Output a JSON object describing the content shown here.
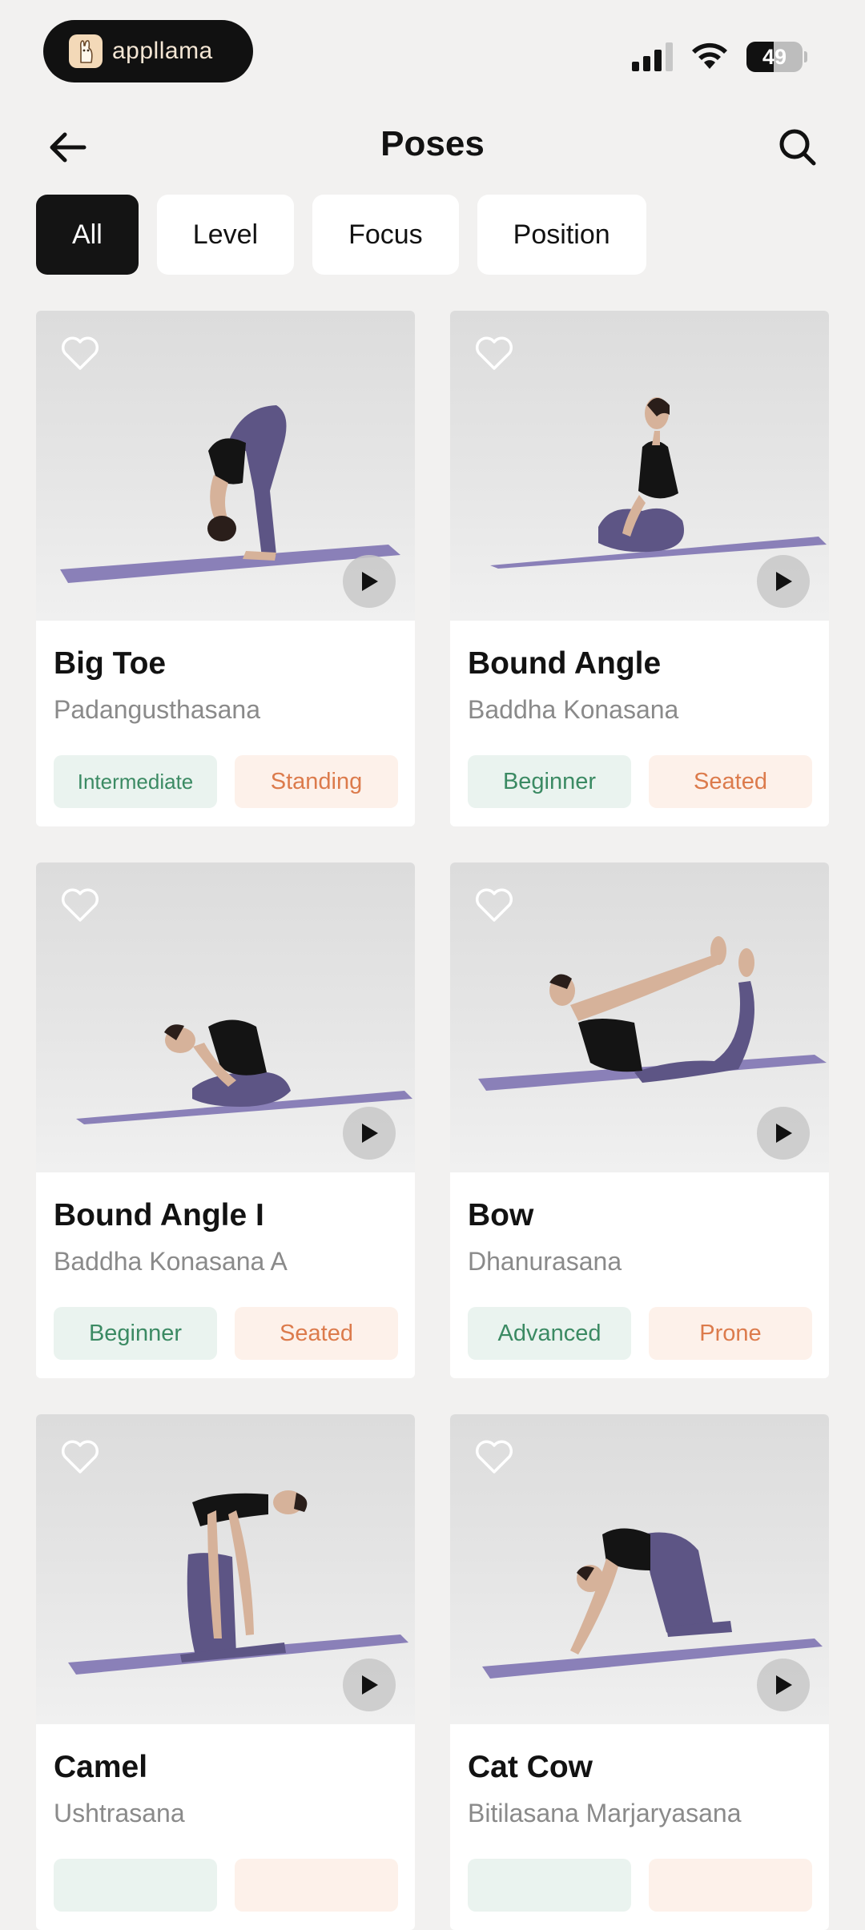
{
  "status_bar": {
    "brand_name": "appllama",
    "battery_level": "49",
    "battery_fraction": 0.49,
    "icons": [
      "app-logo-icon",
      "cellular-signal-icon",
      "wifi-icon",
      "battery-icon"
    ]
  },
  "header": {
    "title": "Poses",
    "back_icon": "arrow-left-icon",
    "search_icon": "search-icon"
  },
  "filters": [
    {
      "label": "All",
      "active": true
    },
    {
      "label": "Level",
      "active": false
    },
    {
      "label": "Focus",
      "active": false
    },
    {
      "label": "Position",
      "active": false
    }
  ],
  "poses": [
    {
      "name": "Big Toe",
      "sanskrit": "Padangusthasana",
      "level": "Intermediate",
      "position": "Standing"
    },
    {
      "name": "Bound Angle",
      "sanskrit": "Baddha Konasana",
      "level": "Beginner",
      "position": "Seated"
    },
    {
      "name": "Bound Angle I",
      "sanskrit": "Baddha Konasana A",
      "level": "Beginner",
      "position": "Seated"
    },
    {
      "name": "Bow",
      "sanskrit": "Dhanurasana",
      "level": "Advanced",
      "position": "Prone"
    },
    {
      "name": "Camel",
      "sanskrit": "Ushtrasana",
      "level": "",
      "position": ""
    },
    {
      "name": "Cat Cow",
      "sanskrit": "Bitilasana Marjaryasana",
      "level": "",
      "position": ""
    }
  ],
  "colors": {
    "background": "#f2f1f0",
    "active_chip": "#141414",
    "level_tag_bg": "#eaf3ef",
    "level_tag_text": "#3b8a63",
    "position_tag_bg": "#fdf1ea",
    "position_tag_text": "#dc7b4c",
    "mat": "#8a80b8",
    "leggings": "#5d5585"
  }
}
